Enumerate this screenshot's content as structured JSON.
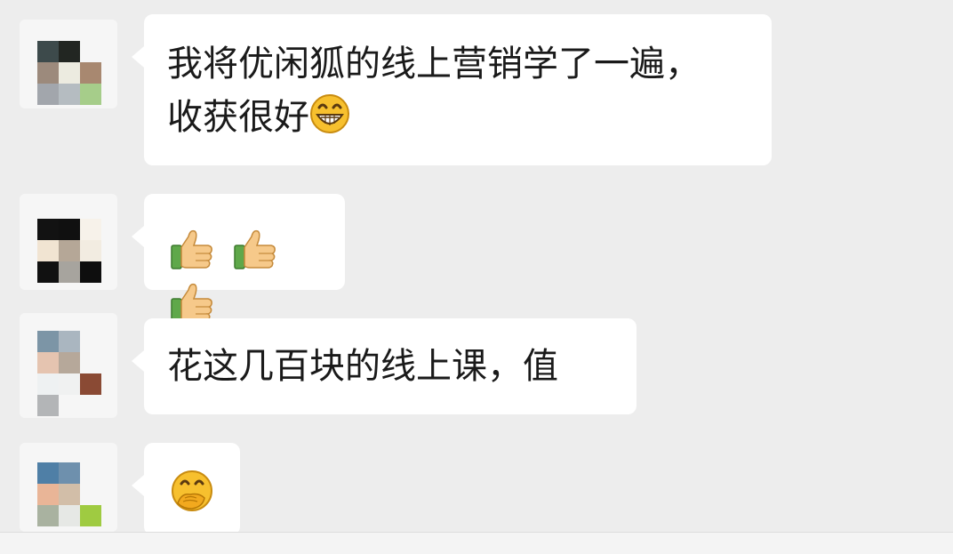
{
  "messages": [
    {
      "lines": [
        "我将优闲狐的线上营销学了一遍，",
        "收获很好"
      ],
      "trailing_emoji": "grinning-face-with-big-eyes-icon"
    },
    {
      "emojis": [
        "thumbs-up-icon",
        "thumbs-up-icon",
        "thumbs-up-icon"
      ]
    },
    {
      "lines": [
        "花这几百块的线上课，值"
      ]
    },
    {
      "emojis": [
        "face-with-hand-over-mouth-icon"
      ]
    }
  ],
  "colors": {
    "background": "#ededed",
    "bubble": "#ffffff",
    "text": "#1a1a1a"
  }
}
